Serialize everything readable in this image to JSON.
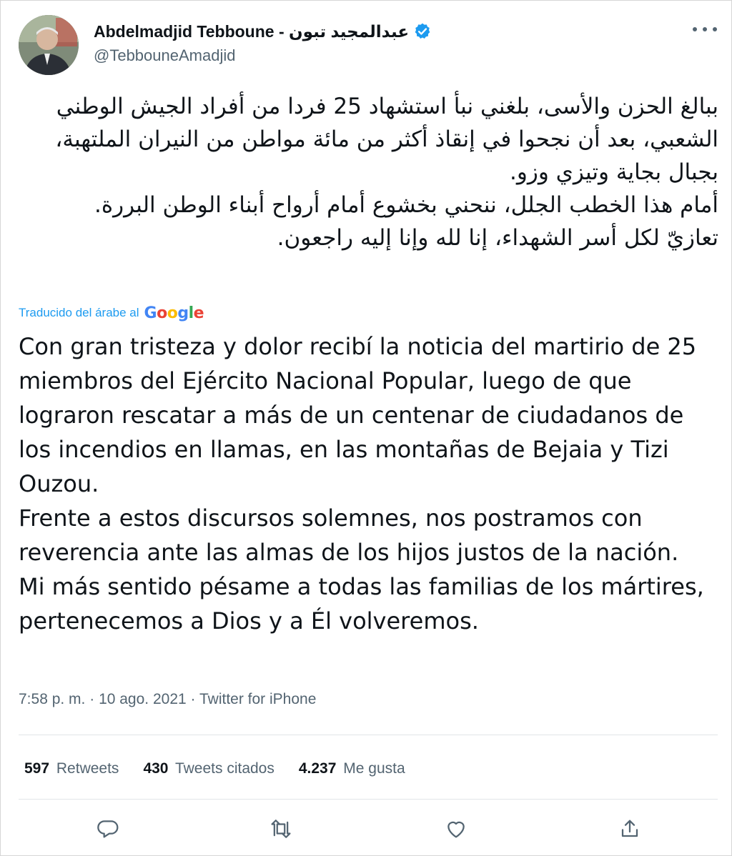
{
  "author": {
    "display_name": "Abdelmadjid Tebboune - عبدالمجيد تبون",
    "handle": "@TebbouneAmadjid",
    "verified": true
  },
  "tweet": {
    "original_paragraphs": [
      "ببالغ الحزن والأسى، بلغني نبأ استشهاد 25 فردا من أفراد الجيش الوطني الشعبي، بعد أن نجحوا في إنقاذ أكثر من مائة مواطن من النيران الملتهبة، بجبال بجاية وتيزي وزو.",
      "أمام هذا الخطب الجلل، ننحني بخشوع أمام أرواح أبناء الوطن البررة.",
      "تعازيّ لكل أسر الشهداء، إنا لله وإنا إليه راجعون."
    ],
    "translation_label": "Traducido del árabe al",
    "translation_provider": "Google",
    "translated_paragraphs": [
      "Con gran tristeza y dolor recibí la noticia del martirio de 25 miembros del Ejército Nacional Popular, luego de que lograron rescatar a más de un centenar de ciudadanos de los incendios en llamas, en las montañas de Bejaia y Tizi Ouzou.",
      " Frente a estos discursos solemnes, nos postramos con reverencia ante las almas de los hijos justos de la nación.",
      " Mi más sentido pésame a todas las familias de los mártires, pertenecemos a Dios y a Él volveremos."
    ],
    "time": "7:58 p. m.",
    "separator": " · ",
    "date": "10 ago. 2021",
    "source": "Twitter for iPhone"
  },
  "stats": {
    "retweets_count": "597",
    "retweets_label": "Retweets",
    "quotes_count": "430",
    "quotes_label": "Tweets citados",
    "likes_count": "4.237",
    "likes_label": "Me gusta"
  },
  "icons": {
    "verified": "verified-badge-icon",
    "more": "more-options-icon",
    "reply": "reply-icon",
    "retweet": "retweet-icon",
    "like": "like-heart-icon",
    "share": "share-icon"
  },
  "colors": {
    "accent": "#1d9bf0",
    "text": "#0f1419",
    "secondary_text": "#536471",
    "divider": "#e1e5e8"
  }
}
